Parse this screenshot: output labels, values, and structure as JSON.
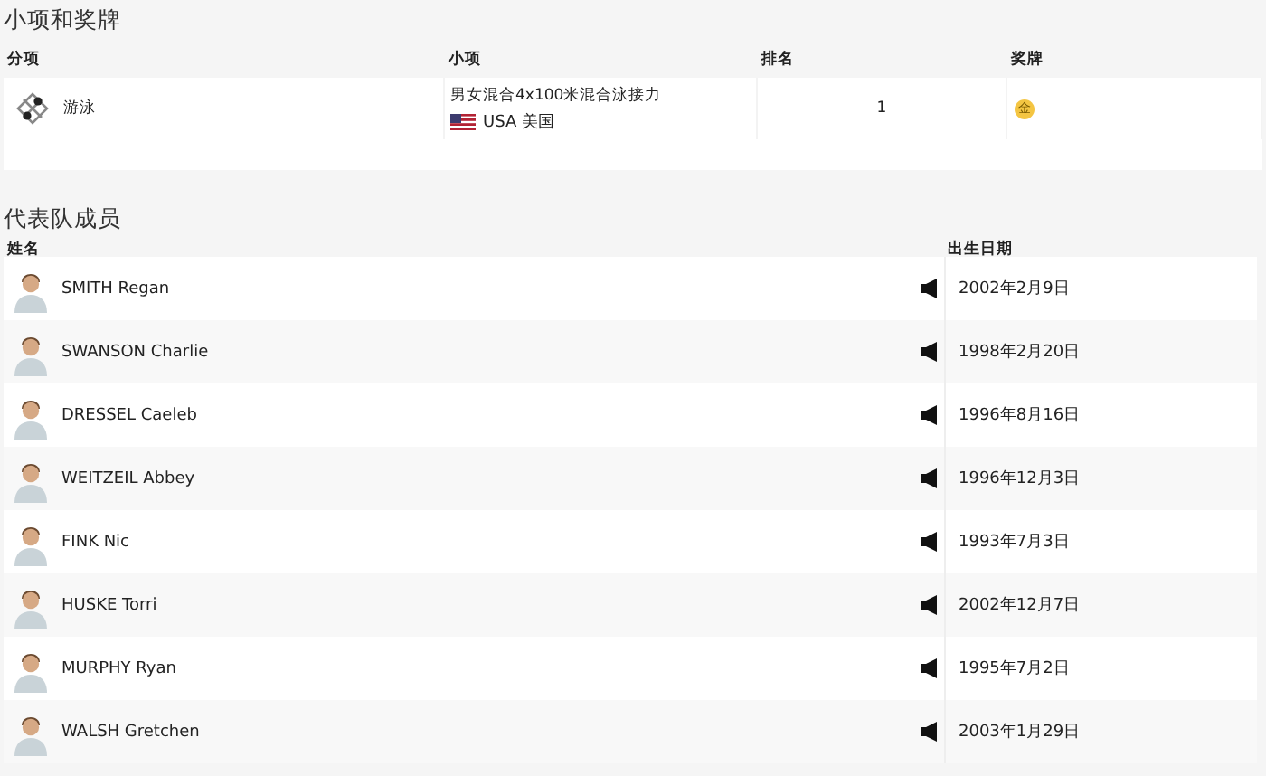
{
  "events_section": {
    "title": "小项和奖牌",
    "columns": [
      "分项",
      "小项",
      "排名",
      "奖牌"
    ],
    "rows": [
      {
        "discipline": "游泳",
        "event": "男女混合4x100米混合泳接力",
        "team": "USA 美国",
        "rank": "1",
        "medal": "金"
      }
    ]
  },
  "roster_section": {
    "title": "代表队成员",
    "columns": [
      "姓名",
      "出生日期"
    ],
    "members": [
      {
        "name": "SMITH Regan",
        "birth_date": "2002年2月9日"
      },
      {
        "name": "SWANSON Charlie",
        "birth_date": "1998年2月20日"
      },
      {
        "name": "DRESSEL Caeleb",
        "birth_date": "1996年8月16日"
      },
      {
        "name": "WEITZEIL Abbey",
        "birth_date": "1996年12月3日"
      },
      {
        "name": "FINK Nic",
        "birth_date": "1993年7月3日"
      },
      {
        "name": "HUSKE Torri",
        "birth_date": "2002年12月7日"
      },
      {
        "name": "MURPHY Ryan",
        "birth_date": "1995年7月2日"
      },
      {
        "name": "WALSH Gretchen",
        "birth_date": "2003年1月29日"
      }
    ]
  }
}
